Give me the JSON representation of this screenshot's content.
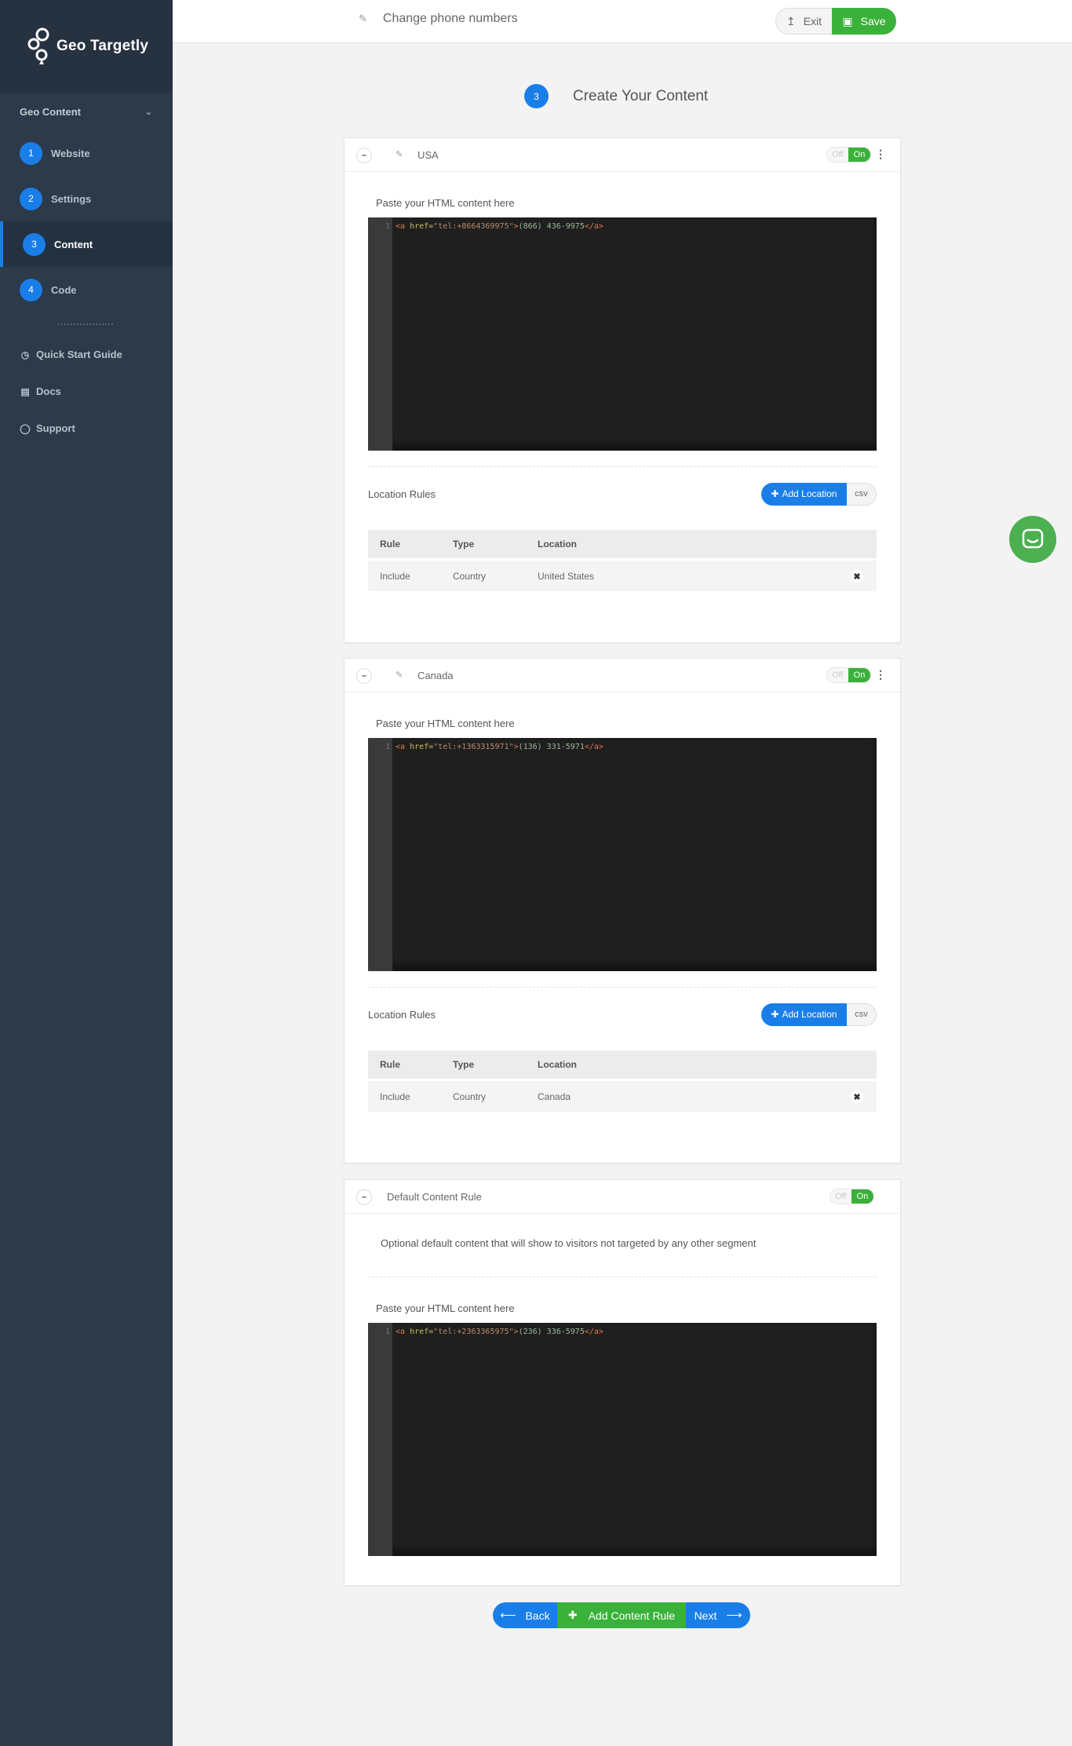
{
  "brand": {
    "name": "Geo Targetly"
  },
  "sidebar": {
    "section": "Geo Content",
    "steps": [
      {
        "num": "1",
        "label": "Website"
      },
      {
        "num": "2",
        "label": "Settings"
      },
      {
        "num": "3",
        "label": "Content"
      },
      {
        "num": "4",
        "label": "Code"
      }
    ],
    "links": [
      {
        "label": "Quick Start Guide",
        "icon": "clock-icon"
      },
      {
        "label": "Docs",
        "icon": "book-icon"
      },
      {
        "label": "Support",
        "icon": "chat-icon"
      }
    ]
  },
  "topbar": {
    "title": "Change phone numbers",
    "exit_label": "Exit",
    "save_label": "Save"
  },
  "heading": {
    "num": "3",
    "text": "Create Your Content"
  },
  "toggle": {
    "off": "Off",
    "on": "On"
  },
  "paste_label": "Paste your HTML content here",
  "location_rules_label": "Location Rules",
  "add_location_label": "Add Location",
  "csv_label": "csv",
  "table_headers": {
    "rule": "Rule",
    "type": "Type",
    "location": "Location"
  },
  "cards": [
    {
      "title": "USA",
      "code_line": "1",
      "code": {
        "tag_open": "<a ",
        "attr": "href=",
        "str": "\"tel:+8664369975\"",
        "tag_gt": ">",
        "text": "(866) 436-9975",
        "tag_close": "</a>"
      },
      "rule": {
        "rule": "Include",
        "type": "Country",
        "location": "United States"
      }
    },
    {
      "title": "Canada",
      "code_line": "1",
      "code": {
        "tag_open": "<a ",
        "attr": "href=",
        "str": "\"tel:+1363315971\"",
        "tag_gt": ">",
        "text": "(136) 331-5971",
        "tag_close": "</a>"
      },
      "rule": {
        "rule": "Include",
        "type": "Country",
        "location": "Canada"
      }
    }
  ],
  "default_card": {
    "title": "Default Content Rule",
    "description": "Optional default content that will show to visitors not targeted by any other segment",
    "code_line": "1",
    "code": {
      "tag_open": "<a ",
      "attr": "href=",
      "str": "\"tel:+2363365975\"",
      "tag_gt": ">",
      "text": "(236) 336-5975",
      "tag_close": "</a>"
    }
  },
  "bottom": {
    "back_label": "Back",
    "add_rule_label": "Add Content Rule",
    "next_label": "Next"
  },
  "colors": {
    "accent": "#1a7ee8",
    "success": "#3ab13a",
    "sidebar": "#2c3a4a"
  }
}
